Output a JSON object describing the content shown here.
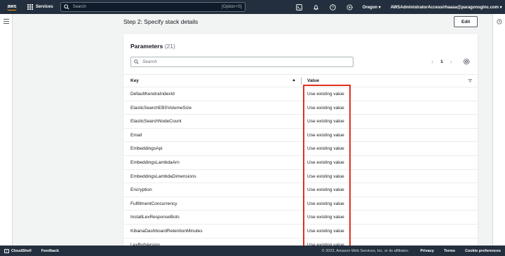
{
  "topnav": {
    "logo_text": "aws",
    "services_label": "Services",
    "search_placeholder": "Search",
    "search_shortcut": "[Option+S]",
    "region": "Oregon ▾",
    "account": "AWSAdministratorAccess/rhaasa@paragonsginc.com ▾"
  },
  "step": {
    "title": "Step 2: Specify stack details",
    "edit_label": "Edit"
  },
  "parameters": {
    "title": "Parameters",
    "count": "(21)",
    "filter_placeholder": "Search",
    "page": "1",
    "columns": {
      "key": "Key",
      "value": "Value"
    },
    "rows": [
      {
        "key": "DefaultKendraIndexId",
        "value": "Use existing value"
      },
      {
        "key": "ElasticSearchEBSVolumeSize",
        "value": "Use existing value"
      },
      {
        "key": "ElasticSearchNodeCount",
        "value": "Use existing value"
      },
      {
        "key": "Email",
        "value": "Use existing value"
      },
      {
        "key": "EmbeddingsApi",
        "value": "Use existing value"
      },
      {
        "key": "EmbeddingsLambdaArn",
        "value": "Use existing value"
      },
      {
        "key": "EmbeddingsLambdaDimensions",
        "value": "Use existing value"
      },
      {
        "key": "Encryption",
        "value": "Use existing value"
      },
      {
        "key": "FulfillmentConcurrency",
        "value": "Use existing value"
      },
      {
        "key": "InstallLexResponseBots",
        "value": "Use existing value"
      },
      {
        "key": "KibanaDashboardRetentionMinutes",
        "value": "Use existing value"
      },
      {
        "key": "LexBotVersion",
        "value": "Use existing value"
      }
    ]
  },
  "footer": {
    "cloudshell": "CloudShell",
    "feedback": "Feedback",
    "copyright": "© 2023, Amazon Web Services, Inc. or its affiliates.",
    "privacy": "Privacy",
    "terms": "Terms",
    "cookies": "Cookie preferences"
  },
  "colors": {
    "nav_bg": "#232f3e",
    "highlight": "#e0301e",
    "brand_orange": "#ff9900"
  }
}
